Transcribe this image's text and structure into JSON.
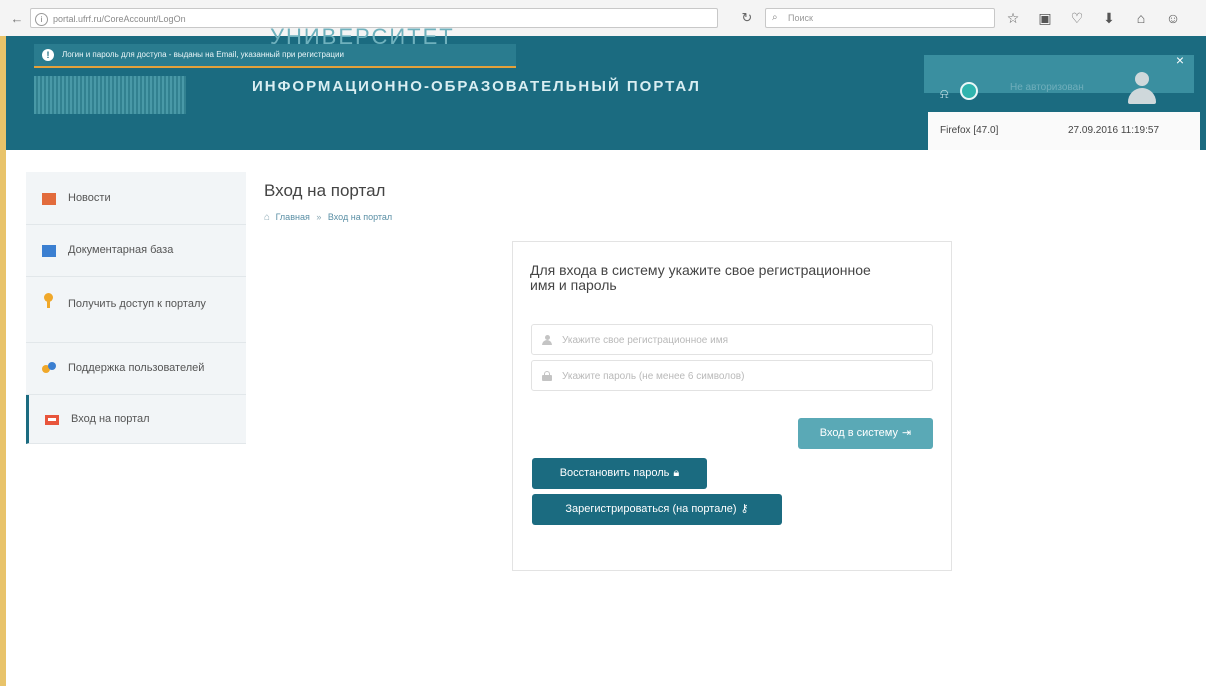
{
  "browser": {
    "url": "portal.ufrf.ru/CoreAccount/LogOn",
    "search_placeholder": "Поиск",
    "nav_back_icon": "back-arrow-icon",
    "reload_icon": "reload-icon",
    "toolbar_icons": [
      "bookmark-star-icon",
      "reading-list-icon",
      "pocket-icon",
      "download-icon",
      "home-icon",
      "menu-icon"
    ]
  },
  "header": {
    "university_title": "УНИВЕРСИТЕТ",
    "portal_title": "ИНФОРМАЦИОННО-ОБРАЗОВАТЕЛЬНЫЙ ПОРТАЛ",
    "notice": "Логин и пароль для доступа - выданы на Email, указанный при регистрации",
    "auth_status": "Не авторизован",
    "browser_label": "Firefox [47.0]",
    "datetime": "27.09.2016 11:19:57",
    "close_symbol": "×"
  },
  "sidebar": {
    "items": [
      {
        "label": "Новости",
        "icon": "news-icon"
      },
      {
        "label": "Документарная база",
        "icon": "document-icon"
      },
      {
        "label": "Получить доступ к порталу",
        "icon": "key-icon"
      },
      {
        "label": "Поддержка пользователей",
        "icon": "users-icon"
      },
      {
        "label": "Вход на портал",
        "icon": "login-icon"
      }
    ],
    "active_index": 4
  },
  "page": {
    "heading": "Вход на портал",
    "breadcrumb": [
      "Главная",
      "Вход на портал"
    ],
    "breadcrumb_sep": "»"
  },
  "login": {
    "title": "Для входа в систему укажите свое регистрационное имя и пароль",
    "username_placeholder": "Укажите свое регистрационное имя",
    "password_placeholder": "Укажите пароль (не менее 6 символов)",
    "login_button": "Вход в систему",
    "restore_button": "Восстановить пароль",
    "register_button": "Зарегистрироваться (на портале)"
  },
  "colors": {
    "header_bg": "#1b6b80",
    "primary_button": "#1b6b80",
    "login_button": "#5aa9b6",
    "notice_underline": "#e4a13a"
  }
}
